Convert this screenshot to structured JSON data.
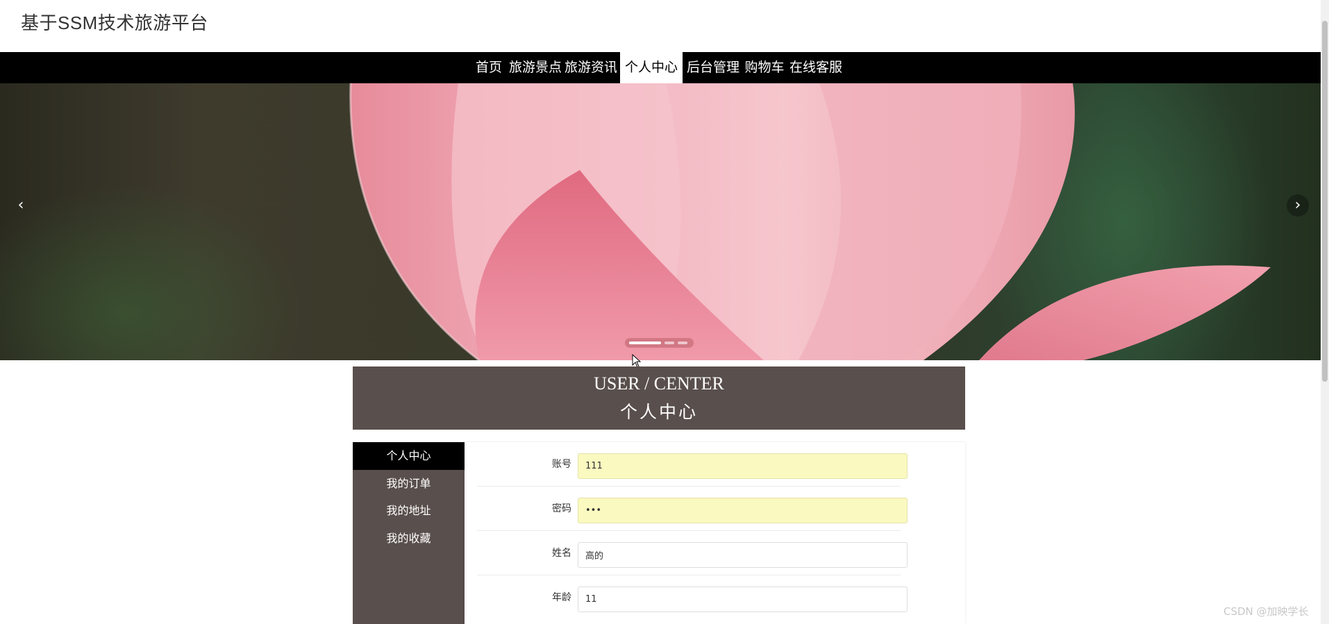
{
  "header": {
    "title": "基于SSM技术旅游平台"
  },
  "nav": {
    "items": [
      {
        "label": "首页",
        "active": false
      },
      {
        "label": "旅游景点",
        "active": false
      },
      {
        "label": "旅游资讯",
        "active": false
      },
      {
        "label": "个人中心",
        "active": true
      },
      {
        "label": "后台管理",
        "active": false
      },
      {
        "label": "购物车",
        "active": false
      },
      {
        "label": "在线客服",
        "active": false
      }
    ]
  },
  "banner": {
    "prev_icon": "chevron-left-icon",
    "next_icon": "chevron-right-icon",
    "prev_glyph": "‹",
    "next_glyph": "›",
    "slide_count": 3,
    "active_slide": 1
  },
  "center": {
    "title_en": "USER / CENTER",
    "title_zh": "个人中心"
  },
  "sidebar": {
    "items": [
      {
        "label": "个人中心",
        "active": true
      },
      {
        "label": "我的订单",
        "active": false
      },
      {
        "label": "我的地址",
        "active": false
      },
      {
        "label": "我的收藏",
        "active": false
      }
    ]
  },
  "form": {
    "fields": [
      {
        "label": "账号",
        "value": "111",
        "type": "text"
      },
      {
        "label": "密码",
        "value": "111",
        "type": "password"
      },
      {
        "label": "姓名",
        "value": "高的",
        "type": "text"
      },
      {
        "label": "年龄",
        "value": "11",
        "type": "text"
      }
    ]
  },
  "watermark": "CSDN @加映学长",
  "colors": {
    "nav_bg": "#000000",
    "panel_bg": "#594f4c",
    "autofill_bg": "#faf9c0"
  }
}
